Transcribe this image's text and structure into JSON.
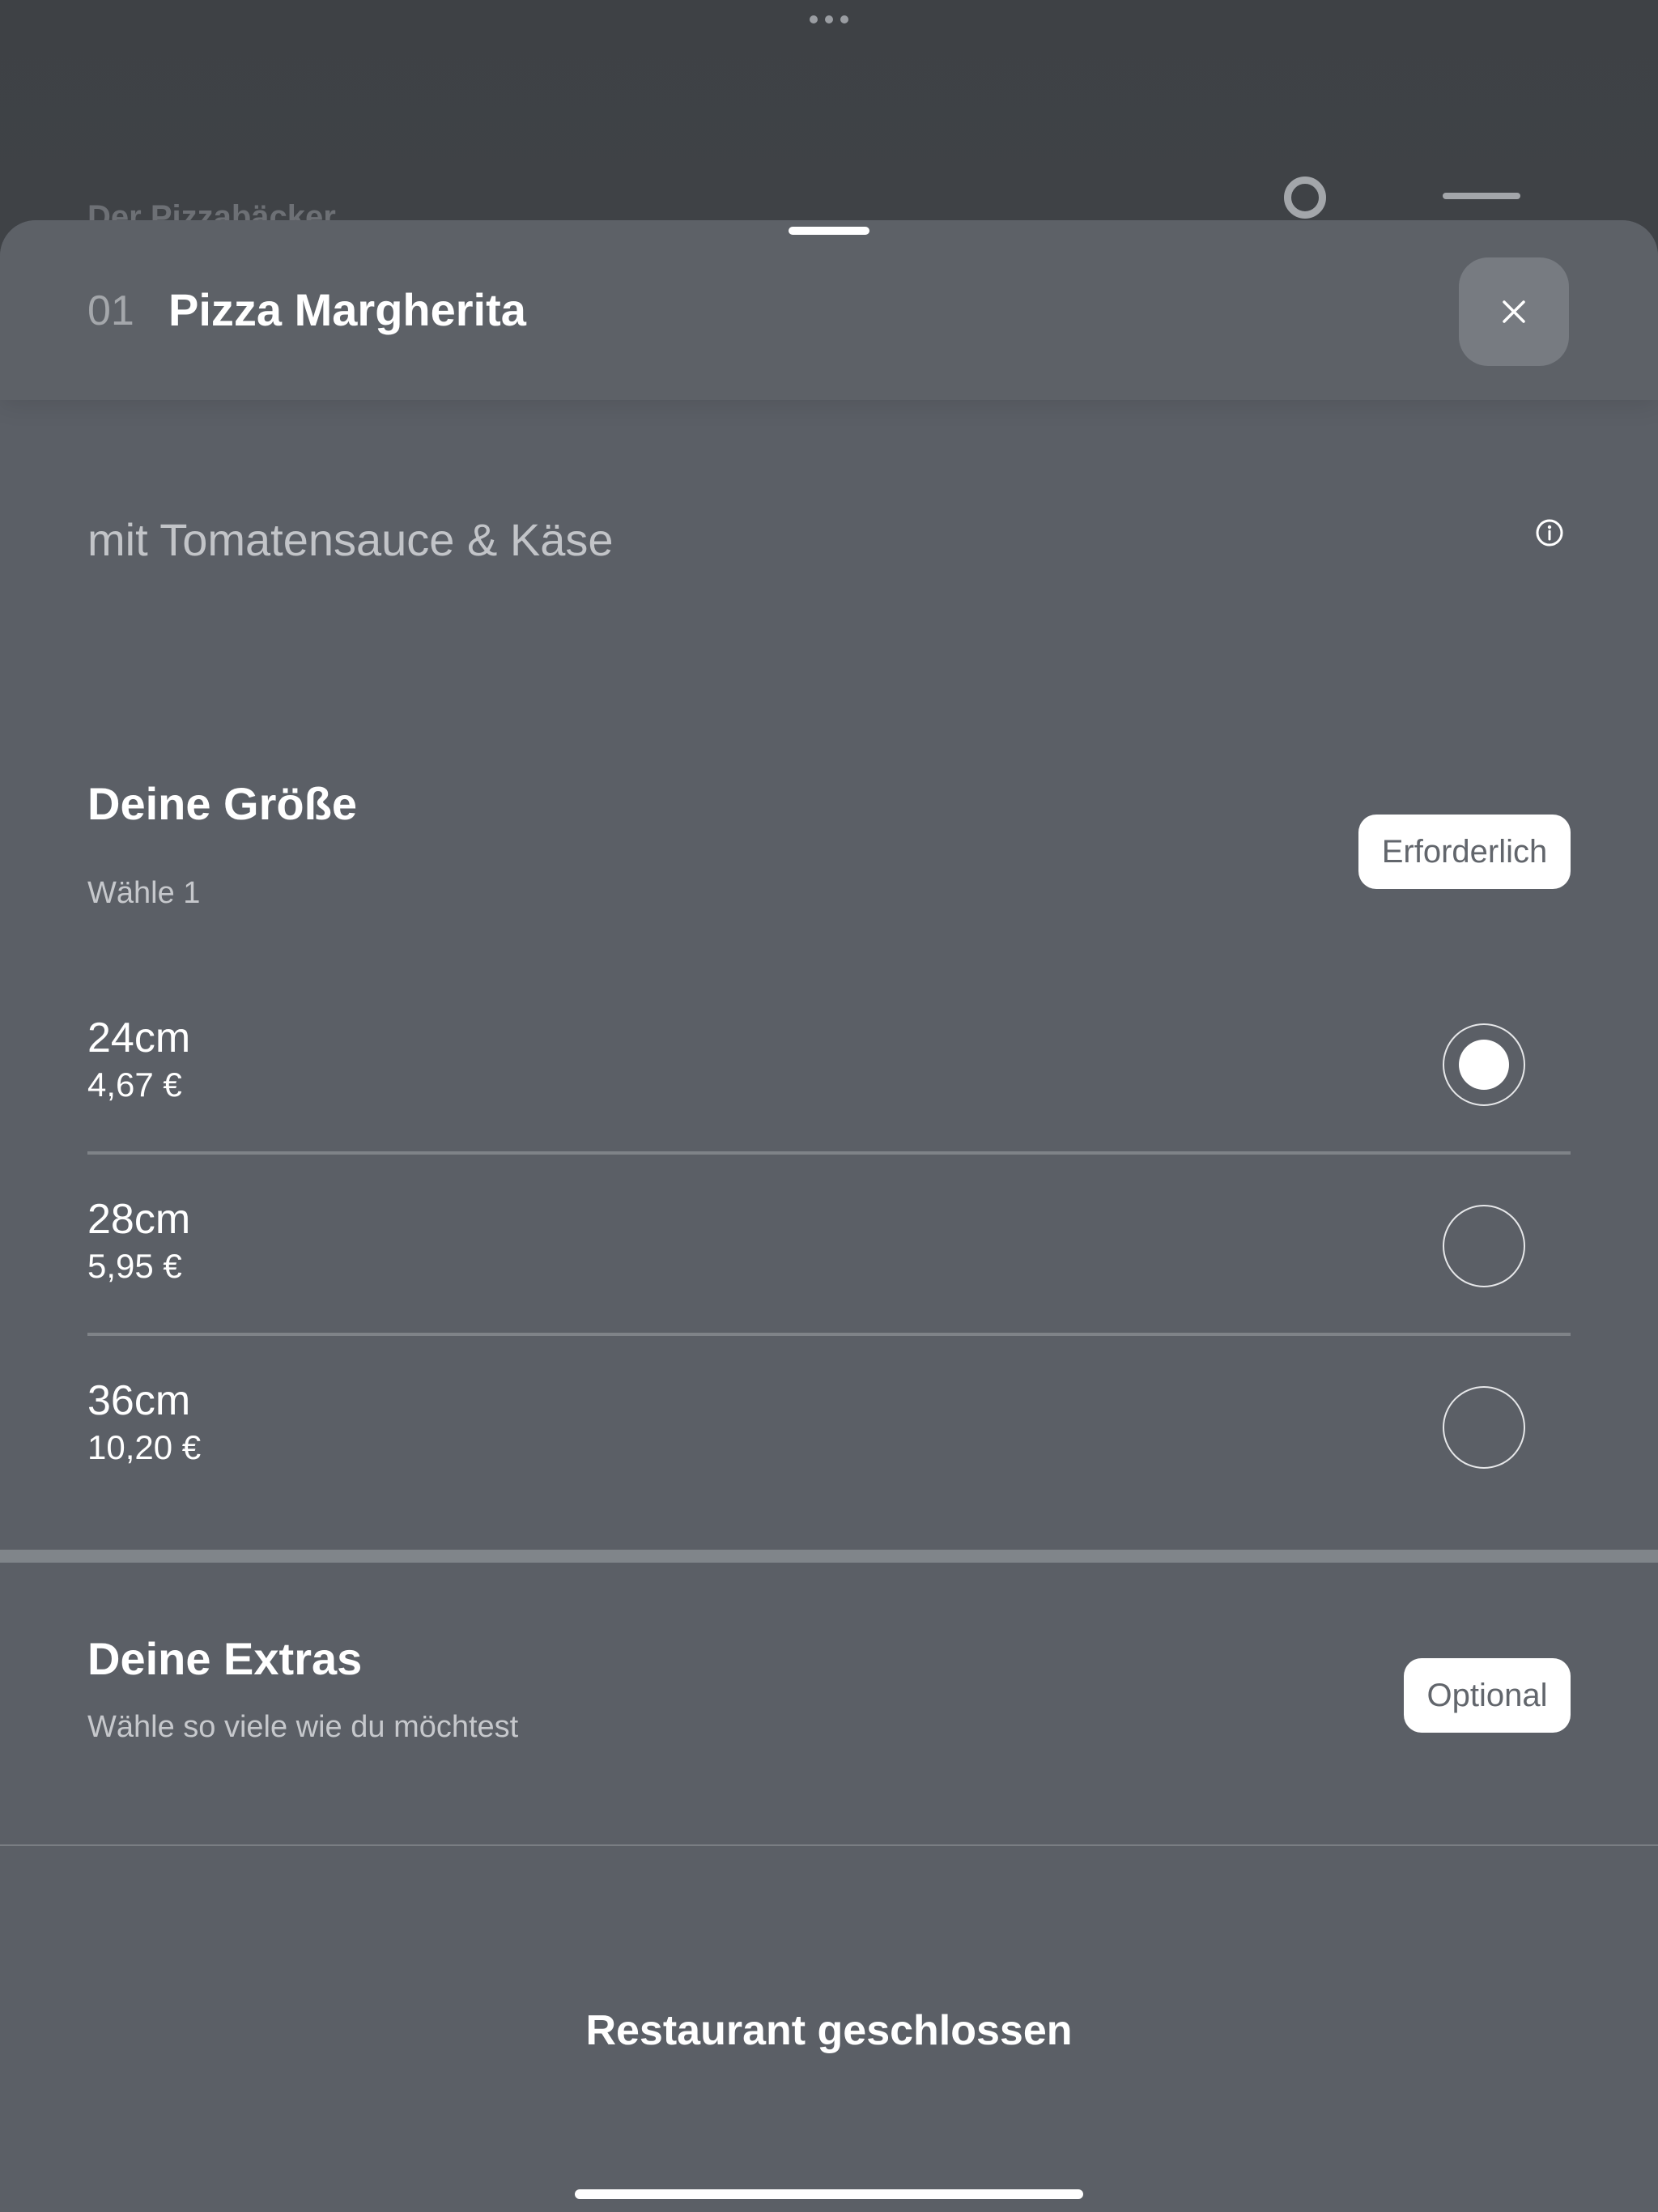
{
  "background_app": {
    "title": "Der Pizzabäcker"
  },
  "header": {
    "item_number": "01",
    "item_title": "Pizza Margherita"
  },
  "description": "mit Tomatensauce & Käse",
  "size_section": {
    "title": "Deine Größe",
    "subtitle": "Wähle 1",
    "badge": "Erforderlich",
    "options": [
      {
        "label": "24cm",
        "price": "4,67 €",
        "selected": true
      },
      {
        "label": "28cm",
        "price": "5,95 €",
        "selected": false
      },
      {
        "label": "36cm",
        "price": "10,20 €",
        "selected": false
      }
    ]
  },
  "extras_section": {
    "title": "Deine Extras",
    "subtitle": "Wähle so viele wie du möchtest",
    "badge": "Optional"
  },
  "footer": {
    "status": "Restaurant geschlossen"
  },
  "colors": {
    "sheet_background": "#5b5f66",
    "badge_background": "#ffffff",
    "close_button": "#777b81"
  }
}
